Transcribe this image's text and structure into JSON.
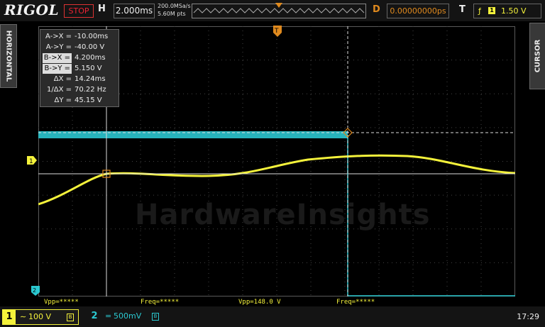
{
  "brand": "RIGOL",
  "status": "STOP",
  "horizontal": {
    "label": "H",
    "timebase": "2.000ms",
    "sample_rate": "200.0MSa/s",
    "memory_depth": "5.60M pts"
  },
  "delay": {
    "label": "D",
    "value": "0.00000000ps"
  },
  "trigger": {
    "label": "T",
    "edge_symbol": "ƒ",
    "source": "1",
    "level": "1.50 V",
    "color": "#f4f23b"
  },
  "side_menus": {
    "left": "HORIZONTAL",
    "right": "CURSOR"
  },
  "cursor_readout": [
    {
      "key": "A->X =",
      "value": "-10.00ms",
      "boxed": false
    },
    {
      "key": "A->Y =",
      "value": "-40.00 V",
      "boxed": false
    },
    {
      "key": "B->X =",
      "value": "4.200ms",
      "boxed": true
    },
    {
      "key": "B->Y =",
      "value": "5.150 V",
      "boxed": true
    },
    {
      "key": "ΔX =",
      "value": "14.24ms",
      "boxed": false
    },
    {
      "key": "1/ΔX =",
      "value": "70.22 Hz",
      "boxed": false
    },
    {
      "key": "ΔY =",
      "value": "45.15 V",
      "boxed": false
    }
  ],
  "channel_markers": {
    "ch1": "1",
    "ch2": "2",
    "trigger_marker": "T"
  },
  "measurements": [
    {
      "text": "Vpp=*****"
    },
    {
      "text": "Freq=*****"
    },
    {
      "text": "Vpp=148.0 V"
    },
    {
      "text": "Freq=*****"
    }
  ],
  "channels": [
    {
      "number": "1",
      "coupling": "∼",
      "scale": "100 V",
      "bw_icon": "B",
      "color": "#f4f23b"
    },
    {
      "number": "2",
      "coupling": "=",
      "scale": "500mV",
      "bw_icon": "B",
      "color": "#2bc9d1"
    }
  ],
  "clock": "17:29",
  "watermark": "HardwareInsights",
  "colors": {
    "ch1": "#f4f23b",
    "ch2": "#2bc9d1",
    "cursor_b": "#e08a1e",
    "stop": "#e23"
  }
}
